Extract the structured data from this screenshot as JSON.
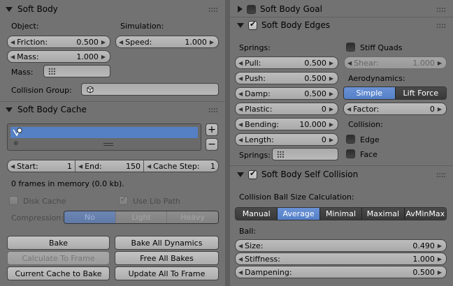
{
  "left": {
    "soft_body": {
      "title": "Soft Body",
      "object_label": "Object:",
      "simulation_label": "Simulation:",
      "friction": {
        "label": "Friction:",
        "value": "0.500"
      },
      "mass": {
        "label": "Mass:",
        "value": "1.000"
      },
      "speed": {
        "label": "Speed:",
        "value": "1.000"
      },
      "mass_group_label": "Mass:",
      "collision_group_label": "Collision Group:"
    },
    "cache": {
      "title": "Soft Body Cache",
      "start": {
        "label": "Start:",
        "value": "1"
      },
      "end": {
        "label": "End:",
        "value": "150"
      },
      "cache_step": {
        "label": "Cache Step:",
        "value": "1"
      },
      "memory_text": "0 frames in memory (0.0 kb).",
      "disk_cache_label": "Disk Cache",
      "use_lib_path_label": "Use Lib Path",
      "compression_label": "Compression:",
      "compression_options": [
        "No",
        "Light",
        "Heavy"
      ],
      "compression_selected": "No",
      "bake": "Bake",
      "bake_all": "Bake All Dynamics",
      "calc_to_frame": "Calculate To Frame",
      "free_all": "Free All Bakes",
      "current_cache": "Current Cache to Bake",
      "update_all": "Update All To Frame"
    }
  },
  "right": {
    "goal": {
      "title": "Soft Body Goal"
    },
    "edges": {
      "title": "Soft Body Edges",
      "springs_label": "Springs:",
      "stiff_quads_label": "Stiff Quads",
      "pull": {
        "label": "Pull:",
        "value": "0.500"
      },
      "shear": {
        "label": "Shear:",
        "value": "1.000"
      },
      "push": {
        "label": "Push:",
        "value": "0.500"
      },
      "aero_label": "Aerodynamics:",
      "damp": {
        "label": "Damp:",
        "value": "0.500"
      },
      "aero_options": [
        "Simple",
        "Lift Force"
      ],
      "aero_selected": "Simple",
      "plastic": {
        "label": "Plastic:",
        "value": "0"
      },
      "factor": {
        "label": "Factor:",
        "value": "0"
      },
      "bending": {
        "label": "Bending:",
        "value": "10.000"
      },
      "collision_label": "Collision:",
      "length": {
        "label": "Length:",
        "value": "0"
      },
      "edge_label": "Edge",
      "springs_group_label": "Springs:",
      "face_label": "Face"
    },
    "self_collision": {
      "title": "Soft Body Self Collision",
      "calc_label": "Collision Ball Size Calculation:",
      "options": [
        "Manual",
        "Average",
        "Minimal",
        "Maximal",
        "AvMinMax"
      ],
      "selected": "Average",
      "ball_label": "Ball:",
      "size": {
        "label": "Size:",
        "value": "0.490"
      },
      "stiffness": {
        "label": "Stiffness:",
        "value": "1.000"
      },
      "dampening": {
        "label": "Dampening:",
        "value": "0.500"
      }
    }
  },
  "colors": {
    "selected": "#5680c4",
    "panel_bg": "#727272",
    "widget": "#b3b3b3"
  }
}
